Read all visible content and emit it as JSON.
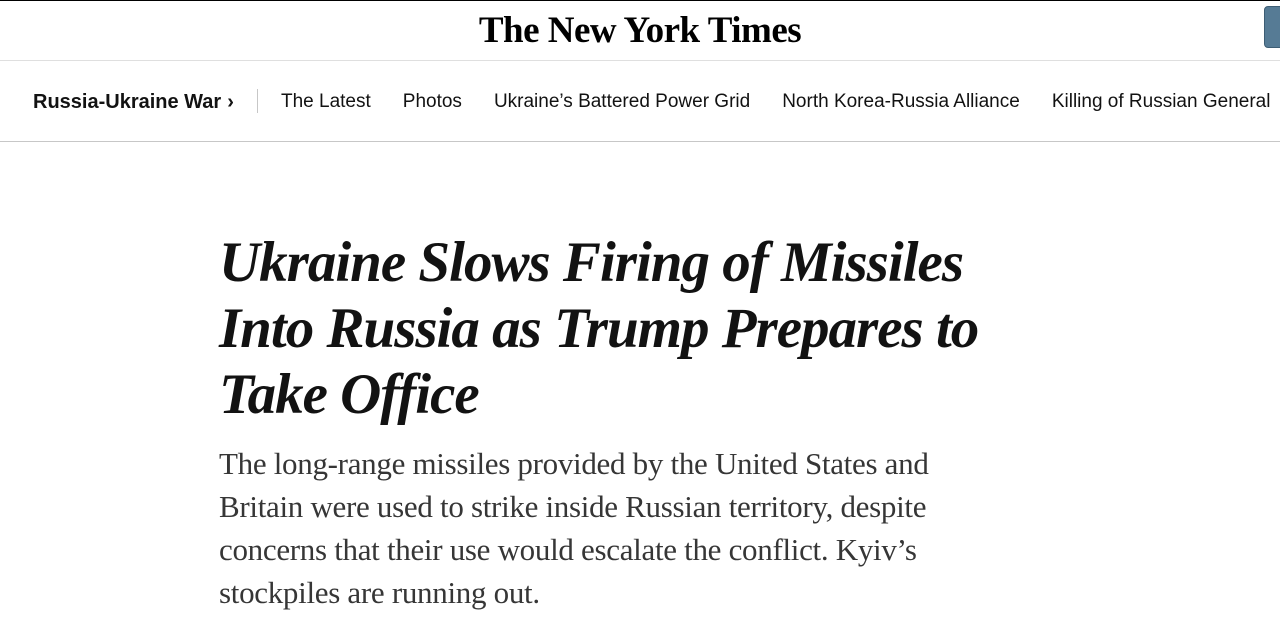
{
  "masthead": {
    "logo_text": "The New York Times",
    "accent_color": "#567b95"
  },
  "nav": {
    "section_label": "Russia-Ukraine War",
    "section_icon": "chevron-right-icon",
    "items": [
      {
        "label": "The Latest"
      },
      {
        "label": "Photos"
      },
      {
        "label": "Ukraine’s Battered Power Grid"
      },
      {
        "label": "North Korea-Russia Alliance"
      },
      {
        "label": "Killing of Russian General"
      }
    ]
  },
  "article": {
    "headline": "Ukraine Slows Firing of Missiles Into Russia as Trump Prepares to Take Office",
    "summary": "The long-range missiles provided by the United States and Britain were used to strike inside Russian territory, despite concerns that their use would escalate the conflict. Kyiv’s stockpiles are running out."
  }
}
